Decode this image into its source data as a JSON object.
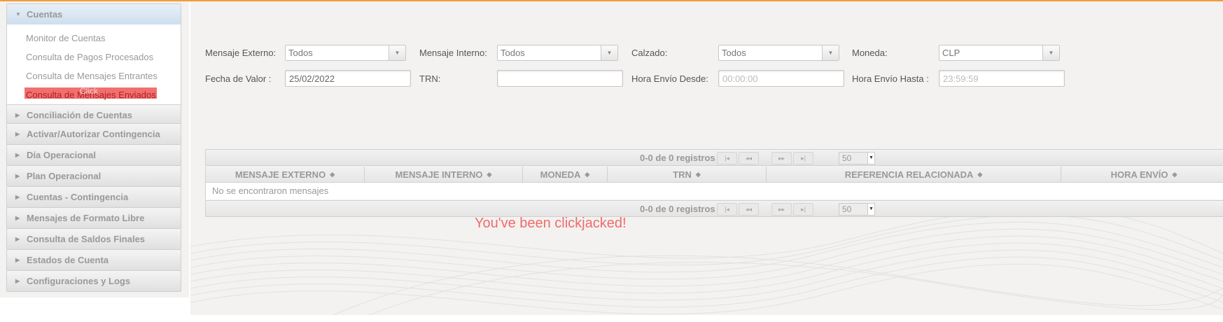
{
  "sidebar": {
    "open_section": {
      "label": "Cuentas",
      "links": [
        {
          "label": "Monitor de Cuentas"
        },
        {
          "label": "Consulta de Pagos Procesados"
        },
        {
          "label": "Consulta de Mensajes Entrantes"
        },
        {
          "label": "Consulta de Mensajes Enviados",
          "overlay": "Click"
        }
      ]
    },
    "sections": [
      {
        "label": "Conciliación de Cuentas"
      },
      {
        "label": "Activar/Autorizar Contingencia"
      },
      {
        "label": "Día Operacional"
      },
      {
        "label": "Plan Operacional"
      },
      {
        "label": "Cuentas - Contingencia"
      },
      {
        "label": "Mensajes de Formato Libre"
      },
      {
        "label": "Consulta de Saldos Finales"
      },
      {
        "label": "Estados de Cuenta"
      },
      {
        "label": "Configuraciones y Logs"
      }
    ]
  },
  "filters": {
    "mensaje_externo": {
      "label": "Mensaje Externo:",
      "value": "Todos"
    },
    "mensaje_interno": {
      "label": "Mensaje Interno:",
      "value": "Todos"
    },
    "calzado": {
      "label": "Calzado:",
      "value": "Todos"
    },
    "moneda": {
      "label": "Moneda:",
      "value": "CLP"
    },
    "fecha_valor": {
      "label": "Fecha de Valor :",
      "value": "25/02/2022"
    },
    "trn": {
      "label": "TRN:",
      "value": ""
    },
    "hora_desde": {
      "label": "Hora Envío Desde:",
      "placeholder": "00:00:00"
    },
    "hora_hasta": {
      "label": "Hora Envío Hasta :",
      "placeholder": "23:59:59"
    }
  },
  "grid": {
    "pager_info": "0-0 de 0 registros",
    "page_size": "50",
    "columns": [
      "MENSAJE EXTERNO",
      "MENSAJE INTERNO",
      "MONEDA",
      "TRN",
      "REFERENCIA RELACIONADA",
      "HORA ENVÍO"
    ],
    "empty_message": "No se encontraron mensajes"
  },
  "clickjack_message": "You've been clickjacked!",
  "colors": {
    "accent": "#f39c3a",
    "alert": "#f26a6a"
  }
}
